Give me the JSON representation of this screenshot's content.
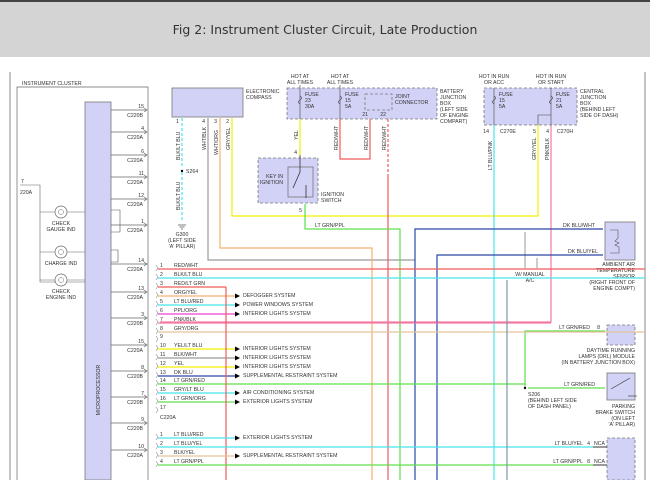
{
  "header": {
    "title": "Fig 2: Instrument Cluster Circuit, Late Production"
  },
  "colors": {
    "red": "#f05a5a",
    "cyan": "#48e4ec",
    "yellow": "#f2f000",
    "green": "#5ee04a",
    "orange": "#f4b26a",
    "pink": "#f07aa4",
    "magenta": "#f040d0",
    "dkblue": "#2a46a8",
    "gray": "#9a9a9a",
    "tan": "#e2c49a",
    "box": "#d2d2f6"
  },
  "cluster": {
    "label": "INSTRUMENT CLUSTER",
    "processor": "MICROPROCESSOR",
    "lamps": [
      [
        "CHECK",
        "GAUGE IND"
      ],
      [
        "CHARGE IND"
      ],
      [
        "CHECK",
        "ENGINE IND"
      ]
    ],
    "side_pin": {
      "pin": "7",
      "conn": "220A"
    },
    "pins": [
      {
        "pin": "15",
        "conn": "C220B"
      },
      {
        "pin": "4",
        "conn": "C220A"
      },
      {
        "pin": "6",
        "conn": "C220A"
      },
      {
        "pin": "11",
        "conn": "C220A"
      },
      {
        "pin": "12",
        "conn": "C220A"
      },
      {
        "pin": "1",
        "conn": "C220A"
      },
      {
        "pin": "14",
        "conn": "C220A"
      },
      {
        "pin": "13",
        "conn": "C220A"
      },
      {
        "pin": "3",
        "conn": "C220B"
      },
      {
        "pin": "15",
        "conn": "C220A"
      },
      {
        "pin": "8",
        "conn": "C220B"
      },
      {
        "pin": "7",
        "conn": "C220B"
      },
      {
        "pin": "9",
        "conn": "C220B"
      },
      {
        "pin": "10",
        "conn": "C220A"
      }
    ]
  },
  "compass": {
    "label": [
      "ELECTRONIC",
      "COMPASS"
    ],
    "pins": [
      "1",
      "4",
      "3",
      "2"
    ],
    "wires": [
      "BLK/LT BLU",
      "WHT/BLK",
      "WHT/ORG",
      "GRY/YEL"
    ],
    "splice": "S264",
    "lower_wire": "BLK/LT BLU",
    "ground": [
      "G300",
      "(LEFT SIDE",
      "'A' PILLAR)"
    ]
  },
  "battery_box": {
    "label": [
      "BATTERY",
      "JUNCTION",
      "BOX",
      "(LEFT SIDE",
      "OF ENGINE",
      "COMPART)"
    ],
    "fuses": [
      {
        "hot": [
          "HOT AT",
          "ALL TIMES"
        ],
        "name": "FUSE",
        "num": "23",
        "amps": "30A"
      },
      {
        "hot": [
          "HOT AT",
          "ALL TIMES"
        ],
        "name": "FUSE",
        "num": "15",
        "amps": "5A"
      }
    ],
    "joint": [
      "JOINT",
      "CONNECTOR"
    ],
    "pins": [
      "21",
      "22"
    ],
    "wires": [
      "YEL",
      "RED/WHT",
      "RED/WHT",
      "RED/WHT"
    ]
  },
  "ignition": {
    "label": [
      "IGNITION",
      "SWITCH"
    ],
    "inner": [
      "KEY IN",
      "IGNITION"
    ],
    "pins": [
      "4",
      "5"
    ],
    "wire": "LT GRN/PPL"
  },
  "central_box": {
    "label": [
      "CENTRAL",
      "JUNCTION",
      "BOX",
      "(BEHIND LEFT",
      "SIDE OF DASH)"
    ],
    "fuses": [
      {
        "hot": [
          "HOT IN RUN",
          "OR ACC"
        ],
        "name": "FUSE",
        "num": "15",
        "amps": "5A"
      },
      {
        "hot": [
          "HOT IN RUN",
          "OR START"
        ],
        "name": "FUSE",
        "num": "21",
        "amps": "5A"
      }
    ],
    "pins": [
      "14",
      "5",
      "4"
    ],
    "conns": [
      "C270E",
      "C270H"
    ],
    "wires": [
      "LT BLU/PNK",
      "GRY/YEL",
      "PNK/BLK"
    ]
  },
  "sensor": {
    "label": [
      "AMBIENT AIR",
      "TEMPERATURE",
      "SENSOR",
      "(RIGHT FRONT OF",
      "ENGINE COMPT)"
    ],
    "wires": [
      "DK BLU/WHT",
      "DK BLU/YEL"
    ],
    "note": [
      "W/ MANUAL",
      "A/C"
    ]
  },
  "drl": {
    "label": [
      "DAYTIME RUNNING",
      "LAMPS (DRL) MODULE",
      "(IN BATTERY JUNCTION BOX)"
    ],
    "wire": "LT GRN/RED",
    "pin": "8"
  },
  "splice2": {
    "lines": [
      "S206",
      "(BEHIND LEFT SIDE",
      "OF DASH PANEL)"
    ]
  },
  "parking": {
    "label": [
      "PARKING",
      "BRAKE SWITCH",
      "(ON LEFT",
      "'A' PILLAR)"
    ],
    "wire": "LT GRN/RED"
  },
  "bottom_module": {
    "rows": [
      {
        "wire": "LT BLU/YEL",
        "pin": "4",
        "nca": "NCA"
      },
      {
        "wire": "LT GRN/PPL",
        "pin": "8",
        "nca": "NCA"
      }
    ]
  },
  "connector_a": {
    "label": "C220A",
    "rows": [
      {
        "pin": "1",
        "wire": "RED/WHT",
        "color": "red",
        "dest": ""
      },
      {
        "pin": "2",
        "wire": "BLK/LT BLU",
        "color": "cyan",
        "dest": ""
      },
      {
        "pin": "3",
        "wire": "RED/LT GRN",
        "color": "red",
        "dest": ""
      },
      {
        "pin": "4",
        "wire": "ORG/YEL",
        "color": "orange",
        "dest": "DEFOGGER SYSTEM"
      },
      {
        "pin": "5",
        "wire": "LT BLU/RED",
        "color": "cyan",
        "dest": "POWER WINDOWS SYSTEM"
      },
      {
        "pin": "6",
        "wire": "PPL/ORG",
        "color": "magenta",
        "dest": "INTERIOR LIGHTS SYSTEM"
      },
      {
        "pin": "7",
        "wire": "PNK/BLK",
        "color": "pink",
        "dest": ""
      },
      {
        "pin": "8",
        "wire": "GRY/ORG",
        "color": "tan",
        "dest": ""
      },
      {
        "pin": "9",
        "wire": "",
        "color": "",
        "dest": ""
      },
      {
        "pin": "10",
        "wire": "YEL/LT BLU",
        "color": "yellow",
        "dest": "INTERIOR LIGHTS SYSTEM"
      },
      {
        "pin": "11",
        "wire": "BLK/WHT",
        "color": "gray",
        "dest": "INTERIOR LIGHTS SYSTEM"
      },
      {
        "pin": "12",
        "wire": "YEL",
        "color": "yellow",
        "dest": "INTERIOR LIGHTS SYSTEM"
      },
      {
        "pin": "13",
        "wire": "DK BLU",
        "color": "dkblue",
        "dest": "SUPPLEMENTAL RESTRAINT SYSTEM"
      },
      {
        "pin": "14",
        "wire": "LT GRN/RED",
        "color": "green",
        "dest": ""
      },
      {
        "pin": "15",
        "wire": "GRY/LT BLU",
        "color": "cyan",
        "dest": "AIR CONDITIONING SYSTEM"
      },
      {
        "pin": "16",
        "wire": "LT GRN/ORG",
        "color": "green",
        "dest": "EXTERIOR LIGHTS SYSTEM"
      },
      {
        "pin": "17",
        "wire": "",
        "color": "",
        "dest": ""
      }
    ]
  },
  "connector_b": {
    "rows": [
      {
        "pin": "1",
        "wire": "LT BLU/RED",
        "color": "cyan",
        "dest": "EXTERIOR LIGHTS SYSTEM"
      },
      {
        "pin": "2",
        "wire": "LT BLU/YEL",
        "color": "cyan",
        "dest": ""
      },
      {
        "pin": "3",
        "wire": "BLK/YEL",
        "color": "tan",
        "dest": "SUPPLEMENTAL RESTRAINT SYSTEM"
      },
      {
        "pin": "4",
        "wire": "LT GRN/PPL",
        "color": "green",
        "dest": ""
      }
    ]
  }
}
